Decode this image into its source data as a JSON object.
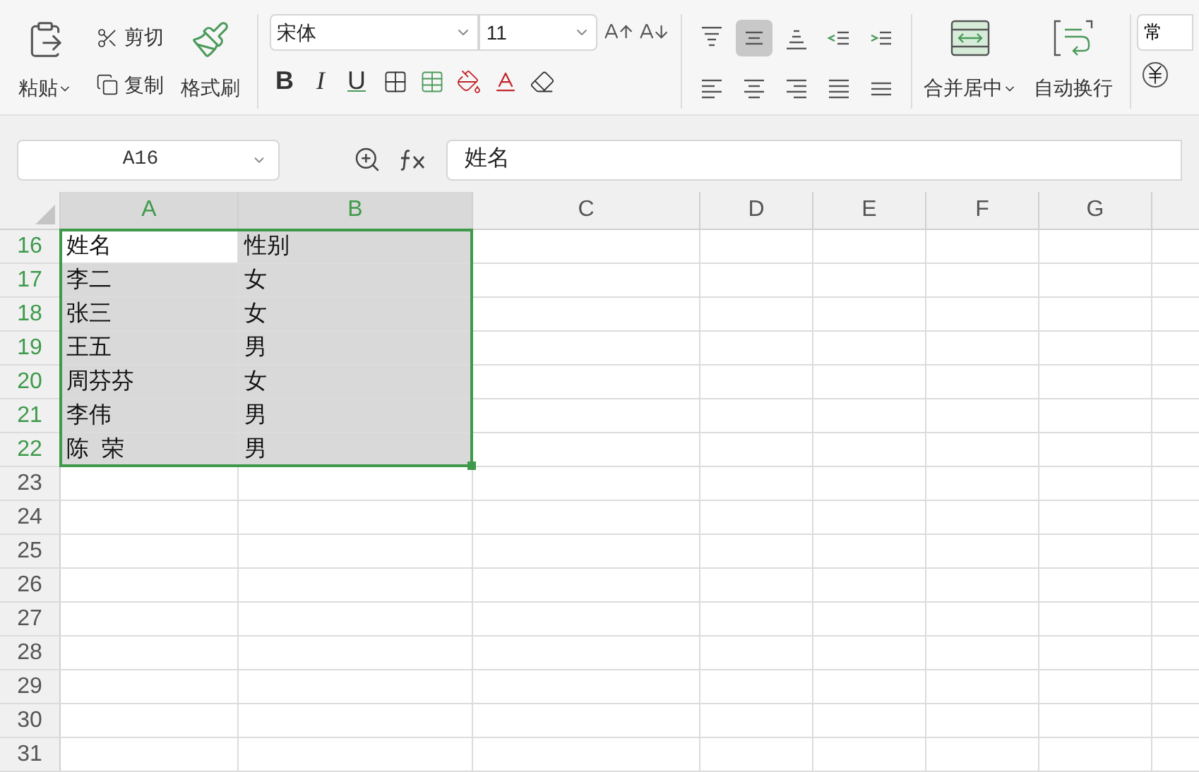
{
  "ribbon": {
    "clipboard": {
      "paste": "粘贴",
      "cut": "剪切",
      "copy": "复制",
      "format_painter": "格式刷"
    },
    "font": {
      "name": "宋体",
      "size": "11",
      "bold": "B",
      "italic": "I",
      "underline": "U"
    },
    "alignment": [
      {
        "kind": "top",
        "selected": false
      },
      {
        "kind": "middle",
        "selected": true
      },
      {
        "kind": "bottom",
        "selected": false
      },
      {
        "kind": "outdent",
        "selected": false
      },
      {
        "kind": "indent",
        "selected": false
      },
      {
        "kind": "left",
        "selected": false
      },
      {
        "kind": "center",
        "selected": false
      },
      {
        "kind": "right",
        "selected": false
      },
      {
        "kind": "justify",
        "selected": false
      },
      {
        "kind": "distributed",
        "selected": false
      }
    ],
    "merge": "合并居中",
    "wrap": "自动换行",
    "number_format": "常"
  },
  "name_box": "A16",
  "formula": "姓名",
  "columns": [
    {
      "label": "A",
      "selected": true
    },
    {
      "label": "B",
      "selected": true
    },
    {
      "label": "C",
      "selected": false
    },
    {
      "label": "D",
      "selected": false
    },
    {
      "label": "E",
      "selected": false
    },
    {
      "label": "F",
      "selected": false
    },
    {
      "label": "G",
      "selected": false
    }
  ],
  "rows": [
    {
      "number": "16",
      "selected": true,
      "cells": [
        {
          "text": "姓名",
          "active": true
        },
        {
          "text": "性别",
          "active": false
        }
      ]
    },
    {
      "number": "17",
      "selected": true,
      "cells": [
        {
          "text": "李二",
          "active": false
        },
        {
          "text": "女",
          "active": false
        }
      ]
    },
    {
      "number": "18",
      "selected": true,
      "cells": [
        {
          "text": "张三",
          "active": false
        },
        {
          "text": "女",
          "active": false
        }
      ]
    },
    {
      "number": "19",
      "selected": true,
      "cells": [
        {
          "text": "王五",
          "active": false
        },
        {
          "text": "男",
          "active": false
        }
      ]
    },
    {
      "number": "20",
      "selected": true,
      "cells": [
        {
          "text": "周芬芬",
          "active": false
        },
        {
          "text": "女",
          "active": false
        }
      ]
    },
    {
      "number": "21",
      "selected": true,
      "cells": [
        {
          "text": "李伟",
          "active": false
        },
        {
          "text": "男",
          "active": false
        }
      ]
    },
    {
      "number": "22",
      "selected": true,
      "cells": [
        {
          "text": "陈  荣",
          "active": false
        },
        {
          "text": "男",
          "active": false
        }
      ]
    },
    {
      "number": "23",
      "selected": false
    },
    {
      "number": "24",
      "selected": false
    },
    {
      "number": "25",
      "selected": false
    },
    {
      "number": "26",
      "selected": false
    },
    {
      "number": "27",
      "selected": false
    },
    {
      "number": "28",
      "selected": false
    },
    {
      "number": "29",
      "selected": false
    },
    {
      "number": "30",
      "selected": false
    },
    {
      "number": "31",
      "selected": false
    }
  ]
}
